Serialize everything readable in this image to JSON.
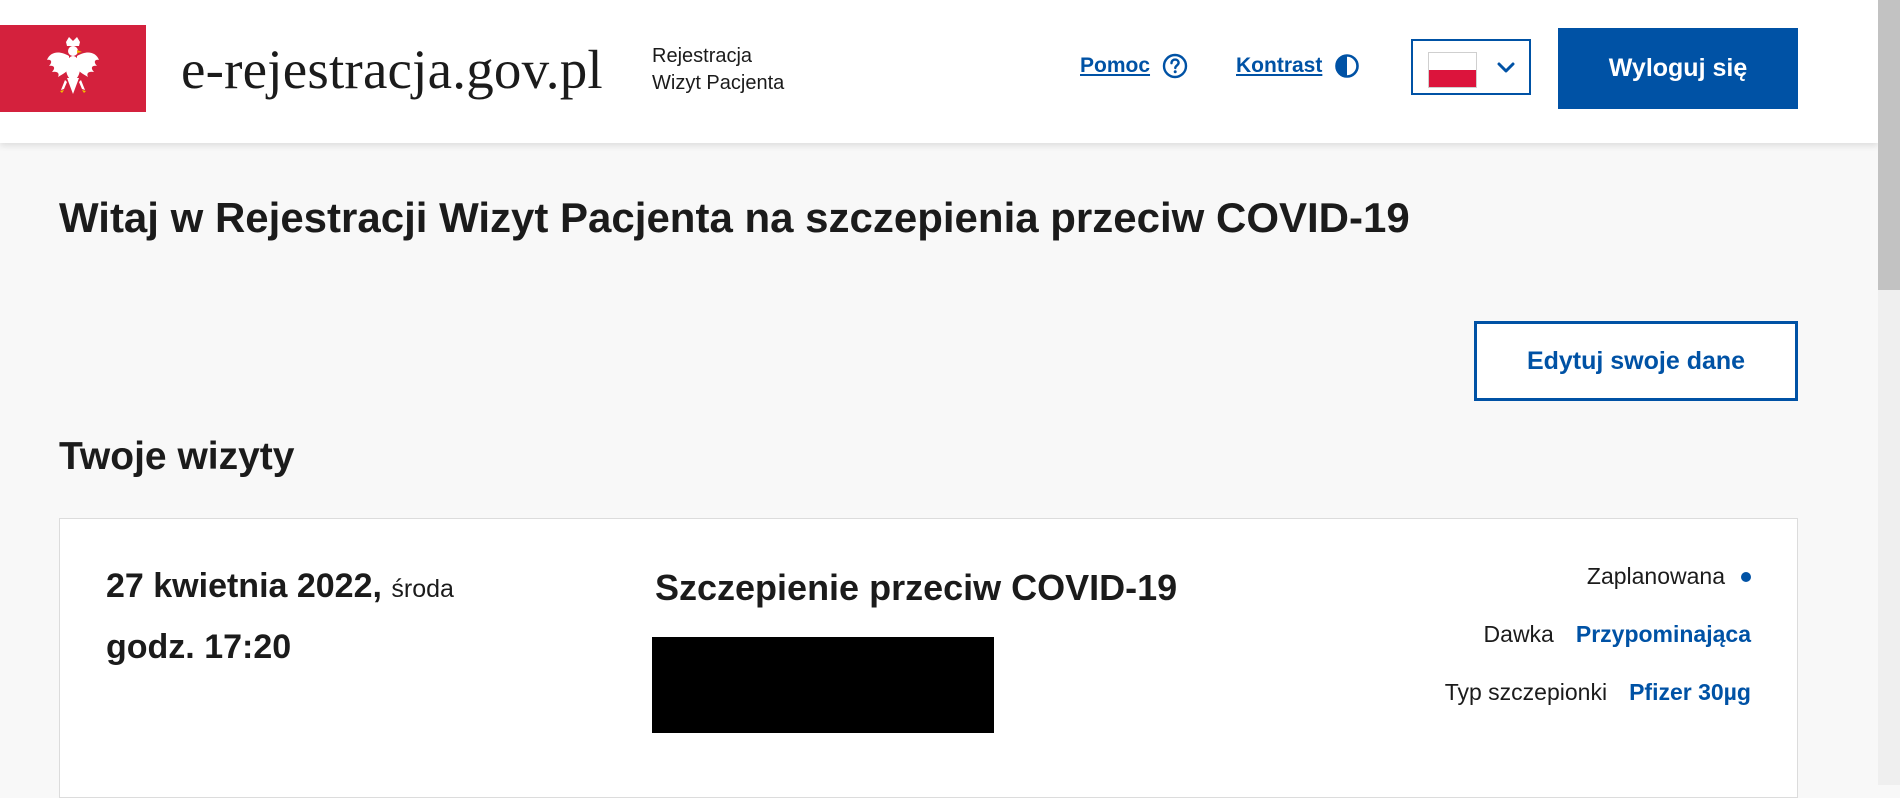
{
  "header": {
    "site_name": "e-rejestracja.gov.pl",
    "app_name_line1": "Rejestracja",
    "app_name_line2": "Wizyt Pacjenta",
    "help_label": "Pomoc",
    "contrast_label": "Kontrast",
    "language": "pl",
    "logout_label": "Wyloguj się",
    "brand_color": "#d4213d",
    "accent_color": "#0052a5"
  },
  "main": {
    "title": "Witaj w Rejestracji Wizyt Pacjenta na szczepienia przeciw COVID-19",
    "edit_button_label": "Edytuj swoje dane",
    "visits_heading": "Twoje wizyty"
  },
  "visit": {
    "date": "27 kwietnia 2022,",
    "weekday": "środa",
    "time": "godz. 17:20",
    "title": "Szczepienie przeciw COVID-19",
    "status": "Zaplanowana",
    "dose_label": "Dawka",
    "dose_value": "Przypominająca",
    "vaccine_label": "Typ szczepionki",
    "vaccine_value": "Pfizer 30µg"
  }
}
